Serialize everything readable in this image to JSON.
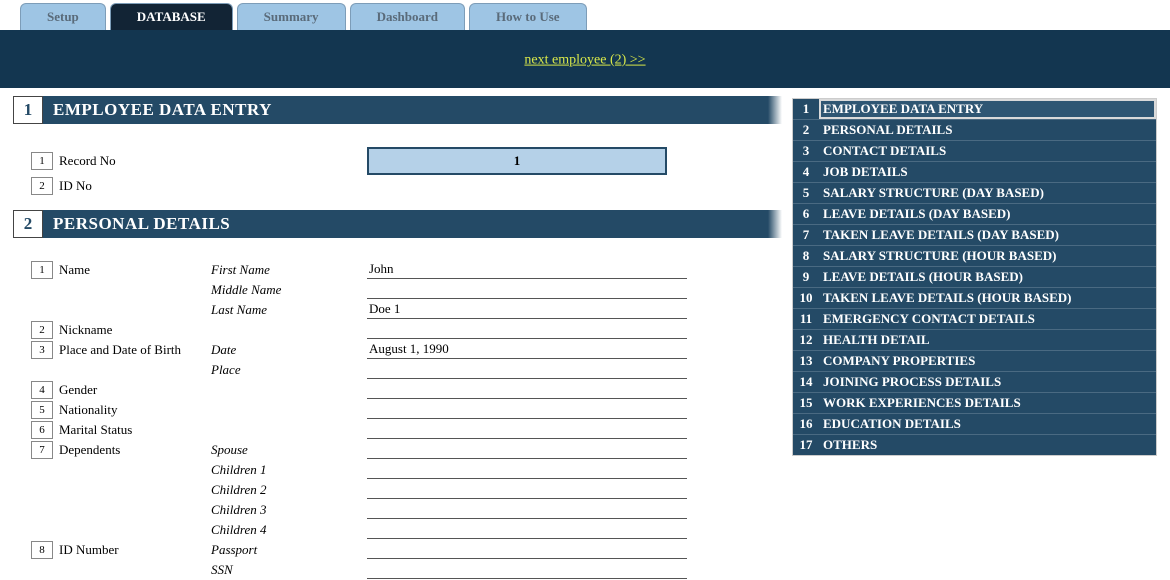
{
  "tabs": [
    {
      "label": "Setup",
      "active": false
    },
    {
      "label": "DATABASE",
      "active": true
    },
    {
      "label": "Summary",
      "active": false
    },
    {
      "label": "Dashboard",
      "active": false
    },
    {
      "label": "How to Use",
      "active": false
    }
  ],
  "next_link": "next employee (2) >>",
  "sections": {
    "s1": {
      "num": "1",
      "title": "EMPLOYEE DATA ENTRY"
    },
    "s2": {
      "num": "2",
      "title": "PERSONAL DETAILS"
    }
  },
  "fields": {
    "record_no": {
      "num": "1",
      "label": "Record No",
      "value": "1"
    },
    "id_no": {
      "num": "2",
      "label": "ID No",
      "value": ""
    },
    "name": {
      "num": "1",
      "label": "Name"
    },
    "first_name": {
      "sublabel": "First Name",
      "value": "John"
    },
    "middle_name": {
      "sublabel": "Middle Name",
      "value": ""
    },
    "last_name": {
      "sublabel": "Last Name",
      "value": "Doe 1"
    },
    "nickname": {
      "num": "2",
      "label": "Nickname",
      "value": ""
    },
    "pdob": {
      "num": "3",
      "label": "Place and Date of Birth"
    },
    "dob_date": {
      "sublabel": "Date",
      "value": "August 1, 1990"
    },
    "dob_place": {
      "sublabel": "Place",
      "value": ""
    },
    "gender": {
      "num": "4",
      "label": "Gender",
      "value": ""
    },
    "nationality": {
      "num": "5",
      "label": "Nationality",
      "value": ""
    },
    "marital": {
      "num": "6",
      "label": "Marital Status",
      "value": ""
    },
    "dependents": {
      "num": "7",
      "label": "Dependents"
    },
    "dep_spouse": {
      "sublabel": "Spouse",
      "value": ""
    },
    "dep_c1": {
      "sublabel": "Children 1",
      "value": ""
    },
    "dep_c2": {
      "sublabel": "Children 2",
      "value": ""
    },
    "dep_c3": {
      "sublabel": "Children 3",
      "value": ""
    },
    "dep_c4": {
      "sublabel": "Children 4",
      "value": ""
    },
    "idnum": {
      "num": "8",
      "label": "ID Number"
    },
    "id_passport": {
      "sublabel": "Passport",
      "value": ""
    },
    "id_ssn": {
      "sublabel": "SSN",
      "value": ""
    }
  },
  "nav": [
    {
      "num": "1",
      "label": "EMPLOYEE DATA ENTRY",
      "selected": true
    },
    {
      "num": "2",
      "label": "PERSONAL DETAILS"
    },
    {
      "num": "3",
      "label": "CONTACT DETAILS"
    },
    {
      "num": "4",
      "label": "JOB DETAILS"
    },
    {
      "num": "5",
      "label": "SALARY STRUCTURE (DAY BASED)"
    },
    {
      "num": "6",
      "label": "LEAVE DETAILS (DAY BASED)"
    },
    {
      "num": "7",
      "label": "TAKEN LEAVE DETAILS (DAY BASED)"
    },
    {
      "num": "8",
      "label": "SALARY STRUCTURE (HOUR BASED)"
    },
    {
      "num": "9",
      "label": "LEAVE DETAILS (HOUR BASED)"
    },
    {
      "num": "10",
      "label": "TAKEN LEAVE DETAILS (HOUR BASED)"
    },
    {
      "num": "11",
      "label": "EMERGENCY CONTACT DETAILS"
    },
    {
      "num": "12",
      "label": "HEALTH DETAIL"
    },
    {
      "num": "13",
      "label": "COMPANY PROPERTIES"
    },
    {
      "num": "14",
      "label": "JOINING PROCESS DETAILS"
    },
    {
      "num": "15",
      "label": "WORK EXPERIENCES DETAILS"
    },
    {
      "num": "16",
      "label": "EDUCATION DETAILS"
    },
    {
      "num": "17",
      "label": "OTHERS"
    }
  ]
}
